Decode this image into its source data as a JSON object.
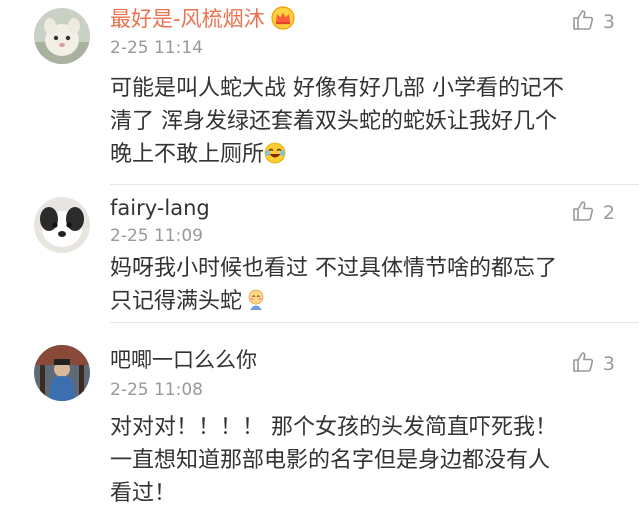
{
  "comments": [
    {
      "username": "最好是-风梳烟沐",
      "username_color": "#eb7350",
      "badge_icon": "crown-vip-icon",
      "time": "2-25 11:14",
      "likes": "3",
      "lines": [
        "可能是叫人蛇大战 好像有好几部 小学看的记不",
        "清了 浑身发绿还套着双头蛇的蛇妖让我好几个",
        "晚上不敢上厕所"
      ],
      "emoji": "crying-laughing-emoji"
    },
    {
      "username": "fairy-lang",
      "username_color": "#333333",
      "time": "2-25 11:09",
      "likes": "2",
      "lines": [
        "妈呀我小时候也看过 不过具体情节啥的都忘了",
        "只记得满头蛇"
      ],
      "emoji": "shy-emoji"
    },
    {
      "username": "吧唧一口么么你",
      "username_color": "#333333",
      "time": "2-25 11:08",
      "likes": "3",
      "lines": [
        "对对对！！！！ 那个女孩的头发简直吓死我！",
        "一直想知道那部电影的名字但是身边都没有人",
        "看过！"
      ]
    }
  ]
}
